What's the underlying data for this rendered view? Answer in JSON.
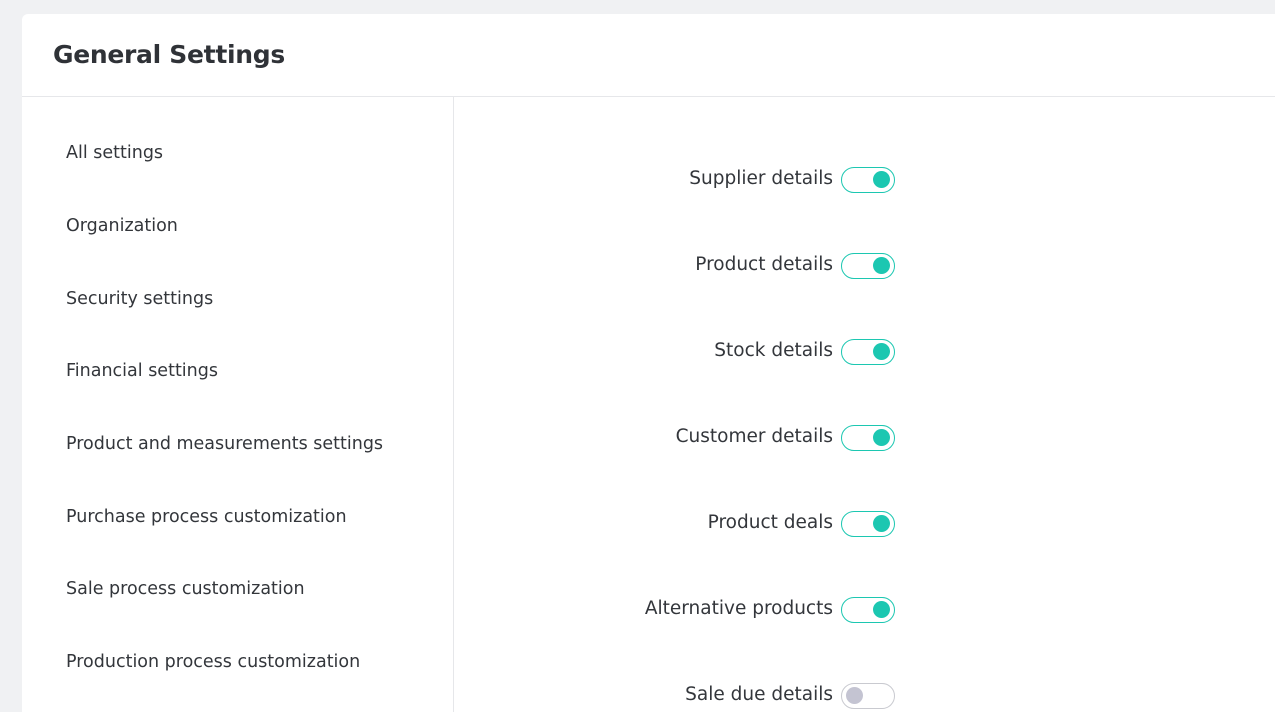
{
  "header": {
    "title": "General Settings"
  },
  "sidebar": {
    "items": [
      {
        "label": "All settings"
      },
      {
        "label": "Organization"
      },
      {
        "label": "Security settings"
      },
      {
        "label": "Financial settings"
      },
      {
        "label": "Product and measurements settings"
      },
      {
        "label": "Purchase process customization"
      },
      {
        "label": "Sale process customization"
      },
      {
        "label": "Production process customization"
      }
    ]
  },
  "settings": [
    {
      "label": "Supplier details",
      "enabled": true
    },
    {
      "label": "Product details",
      "enabled": true
    },
    {
      "label": "Stock details",
      "enabled": true
    },
    {
      "label": "Customer details",
      "enabled": true
    },
    {
      "label": "Product deals",
      "enabled": true
    },
    {
      "label": "Alternative products",
      "enabled": true
    },
    {
      "label": "Sale due details",
      "enabled": false
    }
  ],
  "colors": {
    "toggle_on": "#1cc7b1",
    "toggle_off_knob": "#c4c4d2",
    "background": "#f0f1f3"
  }
}
